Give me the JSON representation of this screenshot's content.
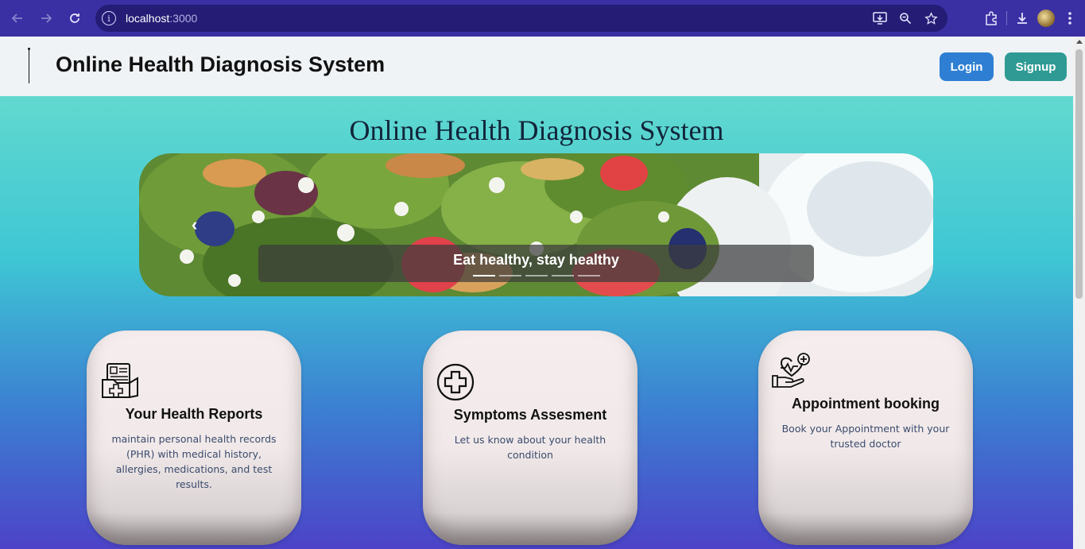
{
  "browser": {
    "url_host": "localhost",
    "url_port": ":3000"
  },
  "header": {
    "title": "Online Health Diagnosis System",
    "login_label": "Login",
    "signup_label": "Signup"
  },
  "hero": {
    "title": "Online Health Diagnosis System",
    "carousel": {
      "caption": "Eat healthy, stay healthy",
      "slide_count": 5,
      "active_index": 0
    }
  },
  "cards": [
    {
      "title": "Your Health Reports",
      "description": "maintain personal health records (PHR) with medical history, allergies, medications, and test results.",
      "icon": "medical-report-icon"
    },
    {
      "title": "Symptoms Assesment",
      "description": "Let us know about your health condition",
      "icon": "medical-cross-icon"
    },
    {
      "title": "Appointment booking",
      "description": "Book your Appointment with your trusted doctor",
      "icon": "heart-hand-icon"
    }
  ],
  "colors": {
    "login": "#2e7fd3",
    "signup": "#2f9a94",
    "chrome": "#3a2fa3"
  }
}
